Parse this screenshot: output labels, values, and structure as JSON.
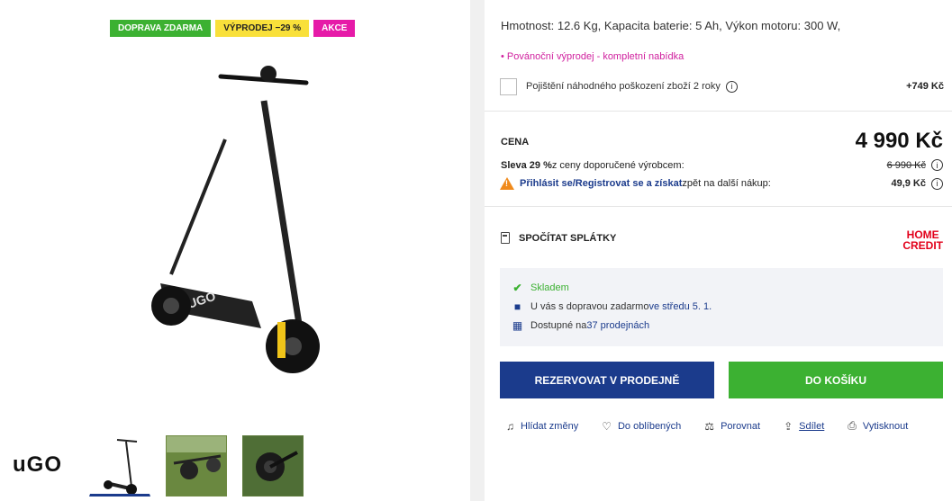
{
  "badges": [
    "DOPRAVA ZDARMA",
    "VÝPRODEJ −29 %",
    "AKCE"
  ],
  "brand": "uGO",
  "specs": "Hmotnost: 12.6 Kg, Kapacita baterie: 5 Ah, Výkon motoru: 300 W,",
  "promo_link": "Povánoční výprodej - kompletní nabídka",
  "insurance": {
    "label": "Pojištění náhodného poškození zboží 2 roky",
    "price": "+749 Kč"
  },
  "price": {
    "label": "CENA",
    "value": "4 990 Kč"
  },
  "discount": {
    "prefix": "Sleva 29 %",
    "text": " z ceny doporučené výrobcem:",
    "old_price": "6 990 Kč"
  },
  "login": {
    "link1": "Přihlásit se",
    "slash": " / ",
    "link2": "Registrovat se a získat",
    "text": " zpět na další nákup:",
    "cashback": "49,9 Kč"
  },
  "installments": {
    "label": "SPOČÍTAT SPLÁTKY",
    "provider_line1": "HOME",
    "provider_line2": "CREDIT"
  },
  "stock": {
    "status": "Skladem",
    "delivery_prefix": "U vás s dopravou zadarmo ",
    "delivery_date": "ve středu 5. 1.",
    "stores_prefix": "Dostupné na ",
    "stores_link": "37 prodejnách"
  },
  "buttons": {
    "reserve": "REZERVOVAT V PRODEJNĚ",
    "cart": "DO KOŠÍKU"
  },
  "actions": [
    "Hlídat změny",
    "Do oblíbených",
    "Porovnat",
    "Sdílet",
    "Vytisknout"
  ],
  "colors": {
    "primary": "#1b3b8c",
    "green": "#3cb132",
    "pink": "#e61aa8",
    "yellow": "#f9e03a",
    "homecredit": "#e2001a"
  }
}
